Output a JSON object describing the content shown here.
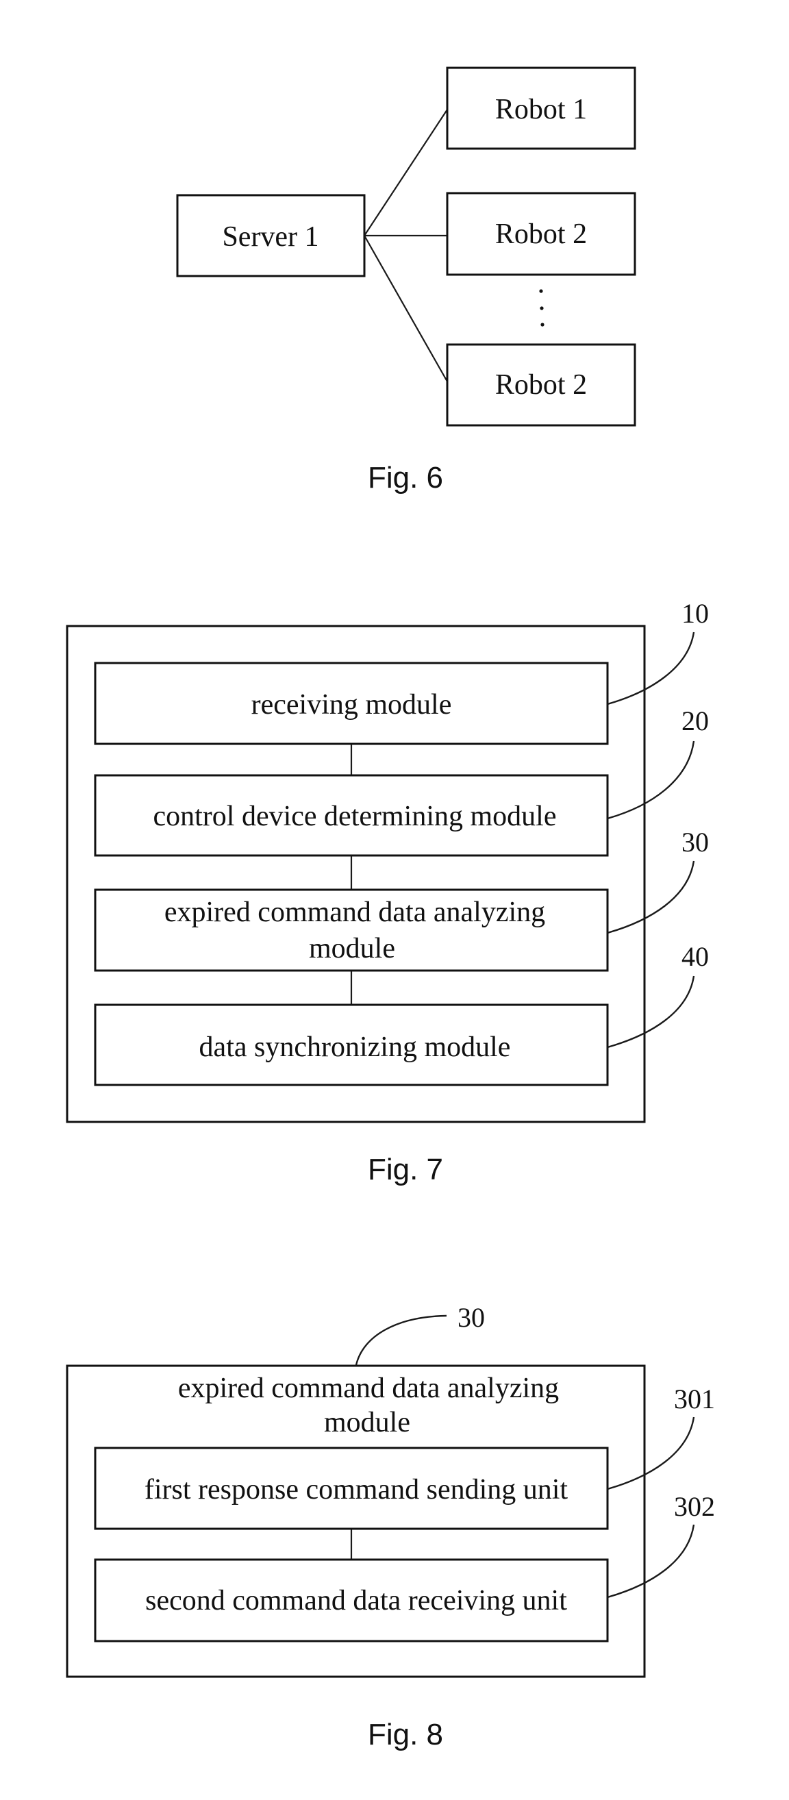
{
  "figures": {
    "fig6": {
      "caption": "Fig. 6",
      "server": "Server 1",
      "robots": [
        "Robot 1",
        "Robot 2",
        "Robot 2"
      ],
      "ellipsis": "vertical-dots"
    },
    "fig7": {
      "caption": "Fig. 7",
      "modules": [
        {
          "ref": "10",
          "lines": [
            "receiving module"
          ]
        },
        {
          "ref": "20",
          "lines": [
            "control device determining module"
          ]
        },
        {
          "ref": "30",
          "lines": [
            "expired command data analyzing",
            "module"
          ]
        },
        {
          "ref": "40",
          "lines": [
            "data synchronizing module"
          ]
        }
      ]
    },
    "fig8": {
      "caption": "Fig. 8",
      "container_ref": "30",
      "container_title": [
        "expired command data analyzing",
        "module"
      ],
      "units": [
        {
          "ref": "301",
          "label": "first response command sending unit"
        },
        {
          "ref": "302",
          "label": "second command data receiving unit"
        }
      ]
    }
  }
}
